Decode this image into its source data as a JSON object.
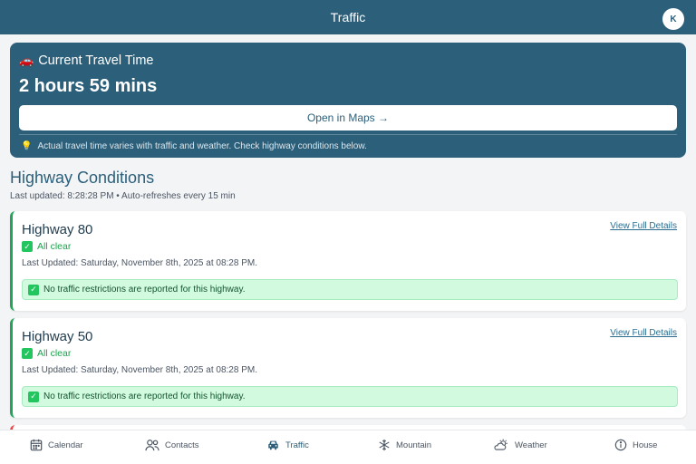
{
  "header": {
    "title": "Traffic",
    "avatar_initial": "K"
  },
  "travel": {
    "heading_icon": "car-icon",
    "heading": "Current Travel Time",
    "time": "2 hours 59 mins",
    "maps_button": "Open in Maps →",
    "tip_icon": "lightbulb-icon",
    "tip": "Actual travel time varies with traffic and weather. Check highway conditions below."
  },
  "conditions": {
    "title": "Highway Conditions",
    "updated": "Last updated: 8:28:28 PM • Auto-refreshes every 15 min",
    "highways": [
      {
        "name": "Highway 80",
        "status": "All clear",
        "last_updated": "Last Updated: Saturday, November 8th, 2025 at 08:28 PM.",
        "notice": "No traffic restrictions are reported for this highway.",
        "link": "View Full Details"
      },
      {
        "name": "Highway 50",
        "status": "All clear",
        "last_updated": "Last Updated: Saturday, November 8th, 2025 at 08:28 PM.",
        "notice": "No traffic restrictions are reported for this highway.",
        "link": "View Full Details"
      }
    ]
  },
  "nav": {
    "items": [
      {
        "label": "Calendar",
        "icon": "calendar-icon"
      },
      {
        "label": "Contacts",
        "icon": "contacts-icon"
      },
      {
        "label": "Traffic",
        "icon": "car-icon",
        "active": true
      },
      {
        "label": "Mountain",
        "icon": "snowflake-icon"
      },
      {
        "label": "Weather",
        "icon": "weather-icon"
      },
      {
        "label": "House",
        "icon": "info-icon"
      }
    ]
  },
  "colors": {
    "primary": "#2c5f7a",
    "success": "#16a34a",
    "success_bg": "#d1fadf",
    "alert": "#ef4444"
  }
}
